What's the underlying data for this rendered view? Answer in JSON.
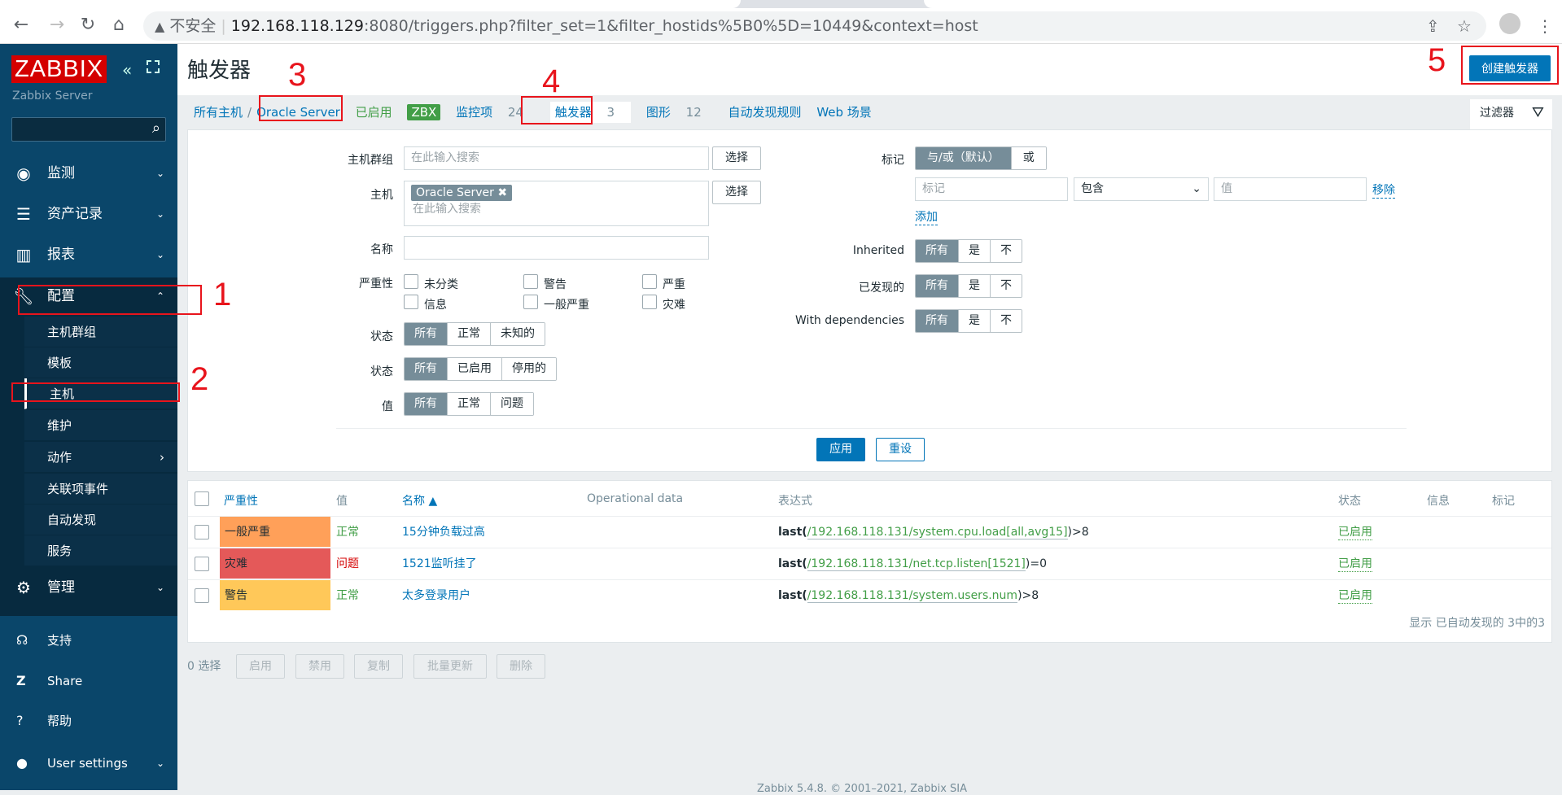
{
  "browser": {
    "security": "不安全",
    "url_host": "192.168.118.129",
    "url_rest": ":8080/triggers.php?filter_set=1&filter_hostids%5B0%5D=10449&context=host"
  },
  "sidebar": {
    "logo": "ZABBIX",
    "server": "Zabbix Server",
    "menu": [
      {
        "label": "监测",
        "icon": "eye-icon"
      },
      {
        "label": "资产记录",
        "icon": "list-icon"
      },
      {
        "label": "报表",
        "icon": "bar-chart-icon"
      },
      {
        "label": "配置",
        "icon": "wrench-icon"
      },
      {
        "label": "管理",
        "icon": "gear-icon"
      }
    ],
    "submenu": [
      "主机群组",
      "模板",
      "主机",
      "维护",
      "动作",
      "关联项事件",
      "自动发现",
      "服务"
    ],
    "bottom": [
      {
        "label": "支持",
        "icon": "headset-icon"
      },
      {
        "label": "Share",
        "icon": "share-z-icon"
      },
      {
        "label": "帮助",
        "icon": "help-icon"
      },
      {
        "label": "User settings",
        "icon": "user-icon"
      }
    ]
  },
  "header": {
    "title": "触发器",
    "create_button": "创建触发器"
  },
  "breadcrumb": {
    "all_hosts": "所有主机",
    "sep": "/",
    "host": "Oracle Server",
    "enabled": "已启用",
    "zbx": "ZBX",
    "items": "监控项",
    "items_count": "24",
    "triggers": "触发器",
    "triggers_count": "3",
    "graphs": "图形",
    "graphs_count": "12",
    "discovery": "自动发现规则",
    "web": "Web 场景"
  },
  "filter_tab": "过滤器",
  "filter": {
    "host_group_label": "主机群组",
    "host_group_placeholder": "在此输入搜索",
    "select": "选择",
    "host_label": "主机",
    "host_selected": "Oracle Server",
    "host_placeholder": "在此输入搜索",
    "name_label": "名称",
    "severity_label": "严重性",
    "severities": [
      "未分类",
      "警告",
      "严重",
      "信息",
      "一般严重",
      "灾难"
    ],
    "state_label": "状态",
    "state_options": [
      "所有",
      "正常",
      "未知的"
    ],
    "status_label": "状态",
    "status_options": [
      "所有",
      "已启用",
      "停用的"
    ],
    "value_label": "值",
    "value_options": [
      "所有",
      "正常",
      "问题"
    ],
    "tags_label": "标记",
    "tags_options": [
      "与/或（默认）",
      "或"
    ],
    "tag_placeholder": "标记",
    "tag_operator": "包含",
    "tag_value_placeholder": "值",
    "remove": "移除",
    "add": "添加",
    "inherited_label": "Inherited",
    "discovered_label": "已发现的",
    "deps_label": "With dependencies",
    "yesno": [
      "所有",
      "是",
      "不"
    ],
    "apply": "应用",
    "reset": "重设"
  },
  "table": {
    "headers": [
      "严重性",
      "值",
      "名称 ▲",
      "Operational data",
      "表达式",
      "状态",
      "信息",
      "标记"
    ],
    "rows": [
      {
        "severity": "一般严重",
        "sev_color": "#ffa059",
        "value": "正常",
        "value_color": "#429e47",
        "name": "15分钟负载过高",
        "fn": "last(",
        "key": "/192.168.118.131/system.cpu.load[all,avg15]",
        "tail": ")>8",
        "status": "已启用"
      },
      {
        "severity": "灾难",
        "sev_color": "#e45959",
        "value": "问题",
        "value_color": "#d40000",
        "name": "1521监听挂了",
        "fn": "last(",
        "key": "/192.168.118.131/net.tcp.listen[1521]",
        "tail": ")=0",
        "status": "已启用"
      },
      {
        "severity": "警告",
        "sev_color": "#ffc859",
        "value": "正常",
        "value_color": "#429e47",
        "name": "太多登录用户",
        "fn": "last(",
        "key": "/192.168.118.131/system.users.num",
        "tail": ")>8",
        "status": "已启用"
      }
    ],
    "summary": "显示 已自动发现的 3中的3"
  },
  "actions": {
    "selected": "0 选择",
    "buttons": [
      "启用",
      "禁用",
      "复制",
      "批量更新",
      "删除"
    ]
  },
  "footer": "Zabbix 5.4.8. © 2001–2021, Zabbix SIA",
  "annotations": [
    "1",
    "2",
    "3",
    "4",
    "5"
  ],
  "colors": {
    "sidebar": "#0a466a",
    "accent": "#0275b8",
    "annotation": "#e8141c"
  }
}
